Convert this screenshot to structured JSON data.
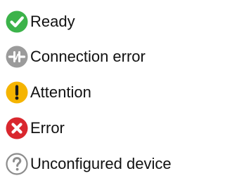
{
  "statuses": [
    {
      "label": "Ready",
      "icon": "check-circle-icon",
      "color": "#3cb34a"
    },
    {
      "label": "Connection error",
      "icon": "disconnected-icon",
      "color": "#9b9b9b"
    },
    {
      "label": "Attention",
      "icon": "exclamation-circle-icon",
      "color": "#f5b400"
    },
    {
      "label": "Error",
      "icon": "x-circle-icon",
      "color": "#d9272e"
    },
    {
      "label": "Unconfigured device",
      "icon": "question-circle-icon",
      "color": "#8c8c8c"
    }
  ]
}
